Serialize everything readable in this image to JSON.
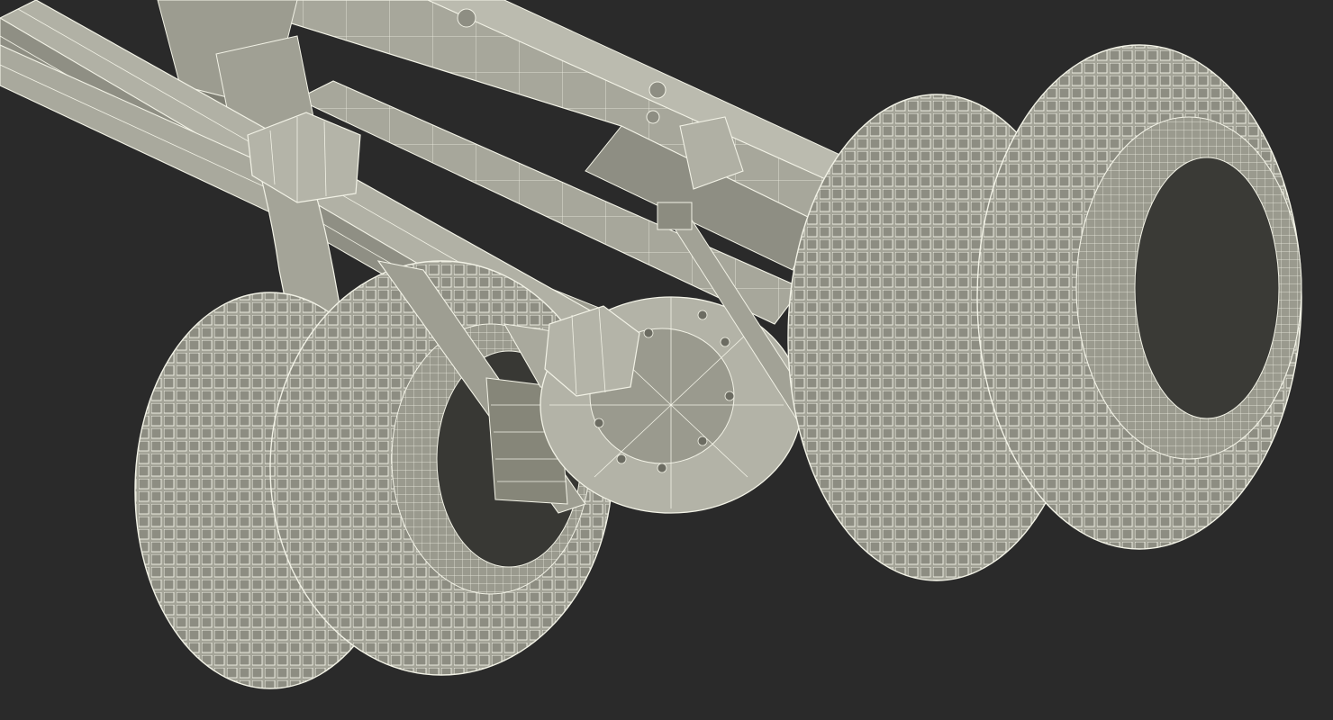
{
  "scene": {
    "background_color": "#2a2a2a",
    "mesh_fill": "#a4a498",
    "mesh_fill_light": "#bbbbaf",
    "mesh_fill_dark": "#77776c",
    "wire_color": "#f2f2e6",
    "shadow_color": "#3c3c36",
    "subject": "truck-rear-axle-wireframe"
  }
}
